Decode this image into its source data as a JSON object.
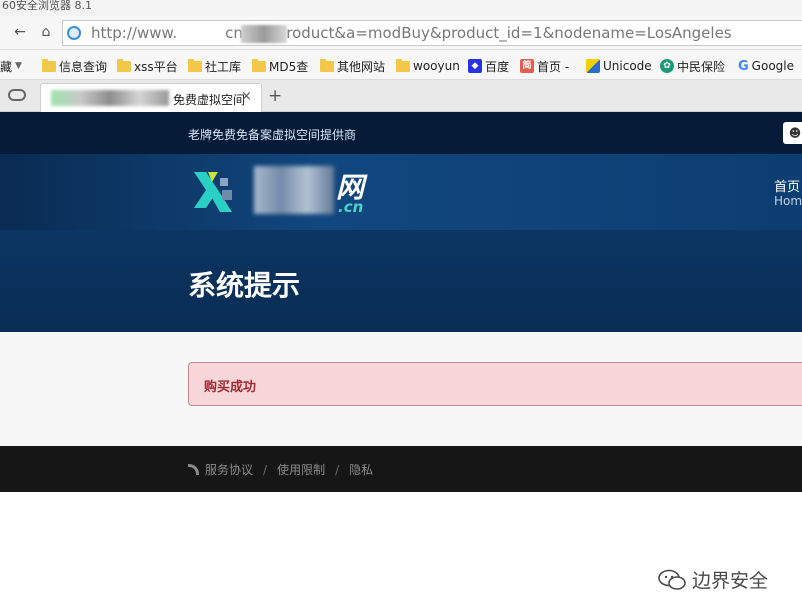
{
  "browser": {
    "window_title": "60安全浏览器 8.1",
    "url_prefix": "http://www.",
    "url_suffix": "cn/?c=product&a=modBuy&product_id=1&nodename=LosAngeles",
    "bookmarks": [
      {
        "label": "藏",
        "icon": "folder-icon"
      },
      {
        "label": "信息查询",
        "icon": "folder-icon"
      },
      {
        "label": "xss平台",
        "icon": "folder-icon"
      },
      {
        "label": "社工库",
        "icon": "folder-icon"
      },
      {
        "label": "MD5查",
        "icon": "folder-icon"
      },
      {
        "label": "其他网站",
        "icon": "folder-icon"
      },
      {
        "label": "wooyun",
        "icon": "folder-icon"
      },
      {
        "label": "百度",
        "icon": "baidu-icon"
      },
      {
        "label": "首页 -",
        "icon": "jian-icon"
      },
      {
        "label": "Unicode",
        "icon": "unicode-icon"
      },
      {
        "label": "中民保险",
        "icon": "zhongmin-icon"
      },
      {
        "label": "Google",
        "icon": "google-icon"
      }
    ],
    "tab_title": "免费虚拟空间",
    "tab_close": "×",
    "tab_add": "+"
  },
  "site": {
    "slogan": "老牌免费免备案虚拟空间提供商",
    "logo_text": "网",
    "logo_domain": ".cn",
    "nav_home": "首页",
    "nav_home_en": "Hom",
    "page_title": "系统提示",
    "alert_message": "购买成功",
    "footer_links": [
      "服务协议",
      "使用限制",
      "隐私"
    ],
    "footer_separator": "/"
  },
  "watermark": {
    "text": "边界安全"
  },
  "colors": {
    "header_dark": "#061b38",
    "header_blue": "#0f3d73",
    "alert_bg": "#f6d6d8",
    "alert_text": "#a22a33",
    "footer_bg": "#161616",
    "logo_accent": "#4dd2c6"
  }
}
